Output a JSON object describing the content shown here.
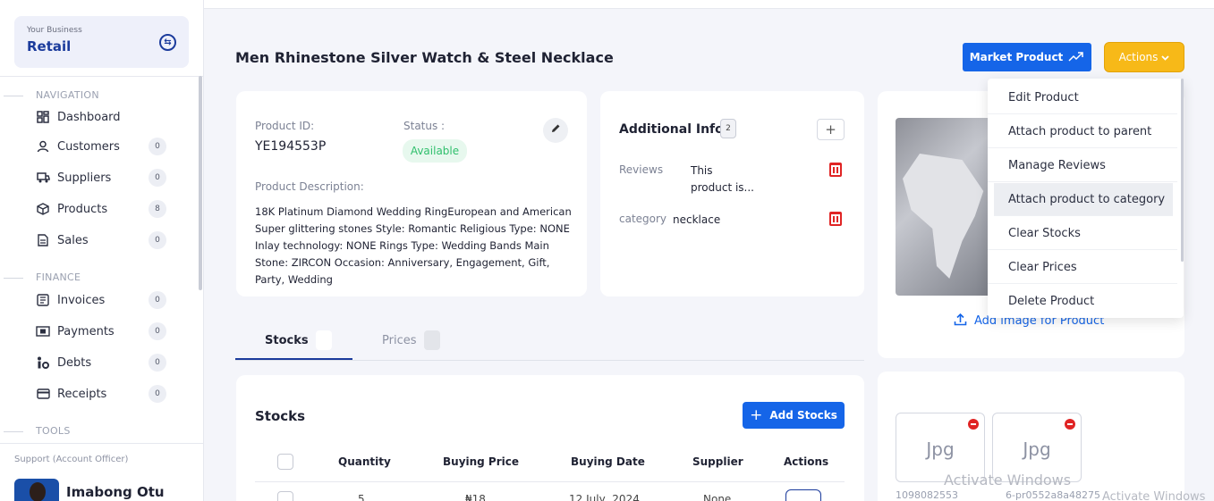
{
  "sidebar": {
    "business_label": "Your Business",
    "business_name": "Retail",
    "sections": {
      "navigation": "NAVIGATION",
      "finance": "FINANCE",
      "tools": "TOOLS"
    },
    "nav_items": [
      {
        "label": "Dashboard",
        "icon": "dashboard-icon"
      },
      {
        "label": "Customers",
        "icon": "user-icon",
        "count": "0"
      },
      {
        "label": "Suppliers",
        "icon": "truck-icon",
        "count": "0"
      },
      {
        "label": "Products",
        "icon": "box-icon",
        "count": "8"
      },
      {
        "label": "Sales",
        "icon": "document-icon",
        "count": "0"
      }
    ],
    "finance_items": [
      {
        "label": "Invoices",
        "icon": "invoice-icon",
        "count": "0"
      },
      {
        "label": "Payments",
        "icon": "money-icon",
        "count": "0"
      },
      {
        "label": "Debts",
        "icon": "debt-icon",
        "count": "0"
      },
      {
        "label": "Receipts",
        "icon": "card-icon",
        "count": "0"
      }
    ],
    "support_label": "Support (Account Officer)",
    "officer_name": "Imabong Otu"
  },
  "header": {
    "title": "Men Rhinestone Silver Watch & Steel Necklace",
    "market_button": "Market Product",
    "actions_button": "Actions"
  },
  "product": {
    "id_label": "Product ID:",
    "id_value": "YE194553P",
    "status_label": "Status :",
    "status_value": "Available",
    "description_label": "Product Description:",
    "description": "18K Platinum Diamond Wedding RingEuropean and American Super glittering stones Style: Romantic Religious Type: NONE Inlay technology: NONE Rings Type: Wedding Bands Main Stone: ZIRCON Occasion: Anniversary, Engagement, Gift, Party, Wedding"
  },
  "additional_info": {
    "title": "Additional Info",
    "count": "2",
    "rows": [
      {
        "key": "Reviews",
        "value_line1": "This",
        "value_line2": "product is..."
      },
      {
        "key": "category",
        "value_line1": "necklace"
      }
    ]
  },
  "image_card": {
    "add_image_label": "Add image for Product"
  },
  "actions_menu": {
    "items": [
      "Edit Product",
      "Attach product to parent",
      "Manage Reviews",
      "Attach product to category",
      "Clear Stocks",
      "Clear Prices",
      "Delete Product"
    ],
    "highlighted": "Attach product to category"
  },
  "tabs": [
    {
      "label": "Stocks",
      "active": true
    },
    {
      "label": "Prices",
      "active": false
    }
  ],
  "stocks": {
    "title": "Stocks",
    "add_button": "Add Stocks",
    "columns": [
      "Quantity",
      "Buying Price",
      "Buying Date",
      "Supplier",
      "Actions"
    ],
    "rows": [
      {
        "quantity": "5",
        "price": "₦18",
        "date": "12 July, 2024",
        "supplier": "None"
      }
    ]
  },
  "thumbnails": [
    {
      "label": "Jpg",
      "filename": "1098082553"
    },
    {
      "label": "Jpg",
      "filename": "6-pr0552a8a48275"
    }
  ],
  "watermark": {
    "title": "Activate Windows",
    "subtitle": "Activate Windows"
  },
  "colors": {
    "primary": "#1565e8",
    "brand_dark": "#1b3b9c",
    "actions": "#f7b918",
    "danger": "#e02424",
    "success": "#2fbf6c"
  }
}
